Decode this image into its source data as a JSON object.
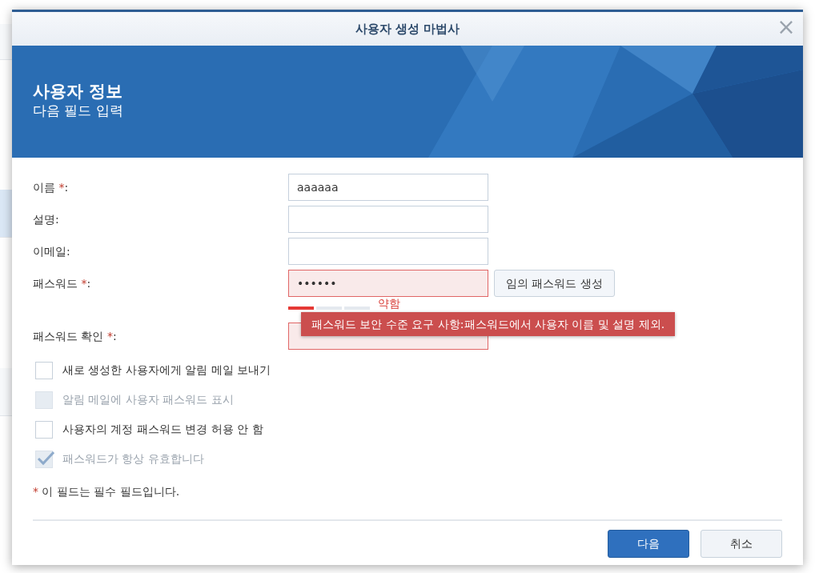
{
  "background": {
    "left_items": [
      {
        "selected": false
      },
      {
        "selected": true
      },
      {
        "selected": false
      }
    ]
  },
  "dialog": {
    "title": "사용자 생성 마법사",
    "close": "×"
  },
  "banner": {
    "title": "사용자 정보",
    "subtitle": "다음 필드 입력"
  },
  "fields": [
    {
      "label": "이름",
      "required": true,
      "colon": ":",
      "value": "aaaaaa",
      "invalid": false
    },
    {
      "label": "설명",
      "required": false,
      "colon": ":",
      "invalid": false
    },
    {
      "label": "이메일",
      "required": false,
      "colon": ":",
      "invalid": false
    },
    {
      "label": "패스워드",
      "required": true,
      "colon": ":",
      "value": "••••••",
      "invalid": true,
      "button": "임의 패스워드 생성",
      "strength": {
        "level": 0.31,
        "label": "약함"
      }
    },
    {
      "label": "패스워드 확인",
      "required": true,
      "colon": ":",
      "invalid": true
    }
  ],
  "tooltip": "패스워드 보안 수준 요구 사항:패스워드에서 사용자 이름 및 설명 제외.",
  "options": [
    {
      "label": "새로 생성한 사용자에게 알림 메일 보내기",
      "checked": false,
      "disabled": false
    },
    {
      "label": "알림 메일에 사용자 패스워드 표시",
      "checked": false,
      "disabled": true
    },
    {
      "label": "사용자의 계정 패스워드 변경 허용 안 함",
      "checked": false,
      "disabled": false
    },
    {
      "label": "패스워드가 항상 유효합니다",
      "checked": true,
      "disabled": true
    }
  ],
  "required_note": {
    "mark": "*",
    "text": "이 필드는 필수 필드입니다."
  },
  "buttons": [
    {
      "label": "다음",
      "primary": true
    },
    {
      "label": "취소",
      "primary": false
    }
  ]
}
